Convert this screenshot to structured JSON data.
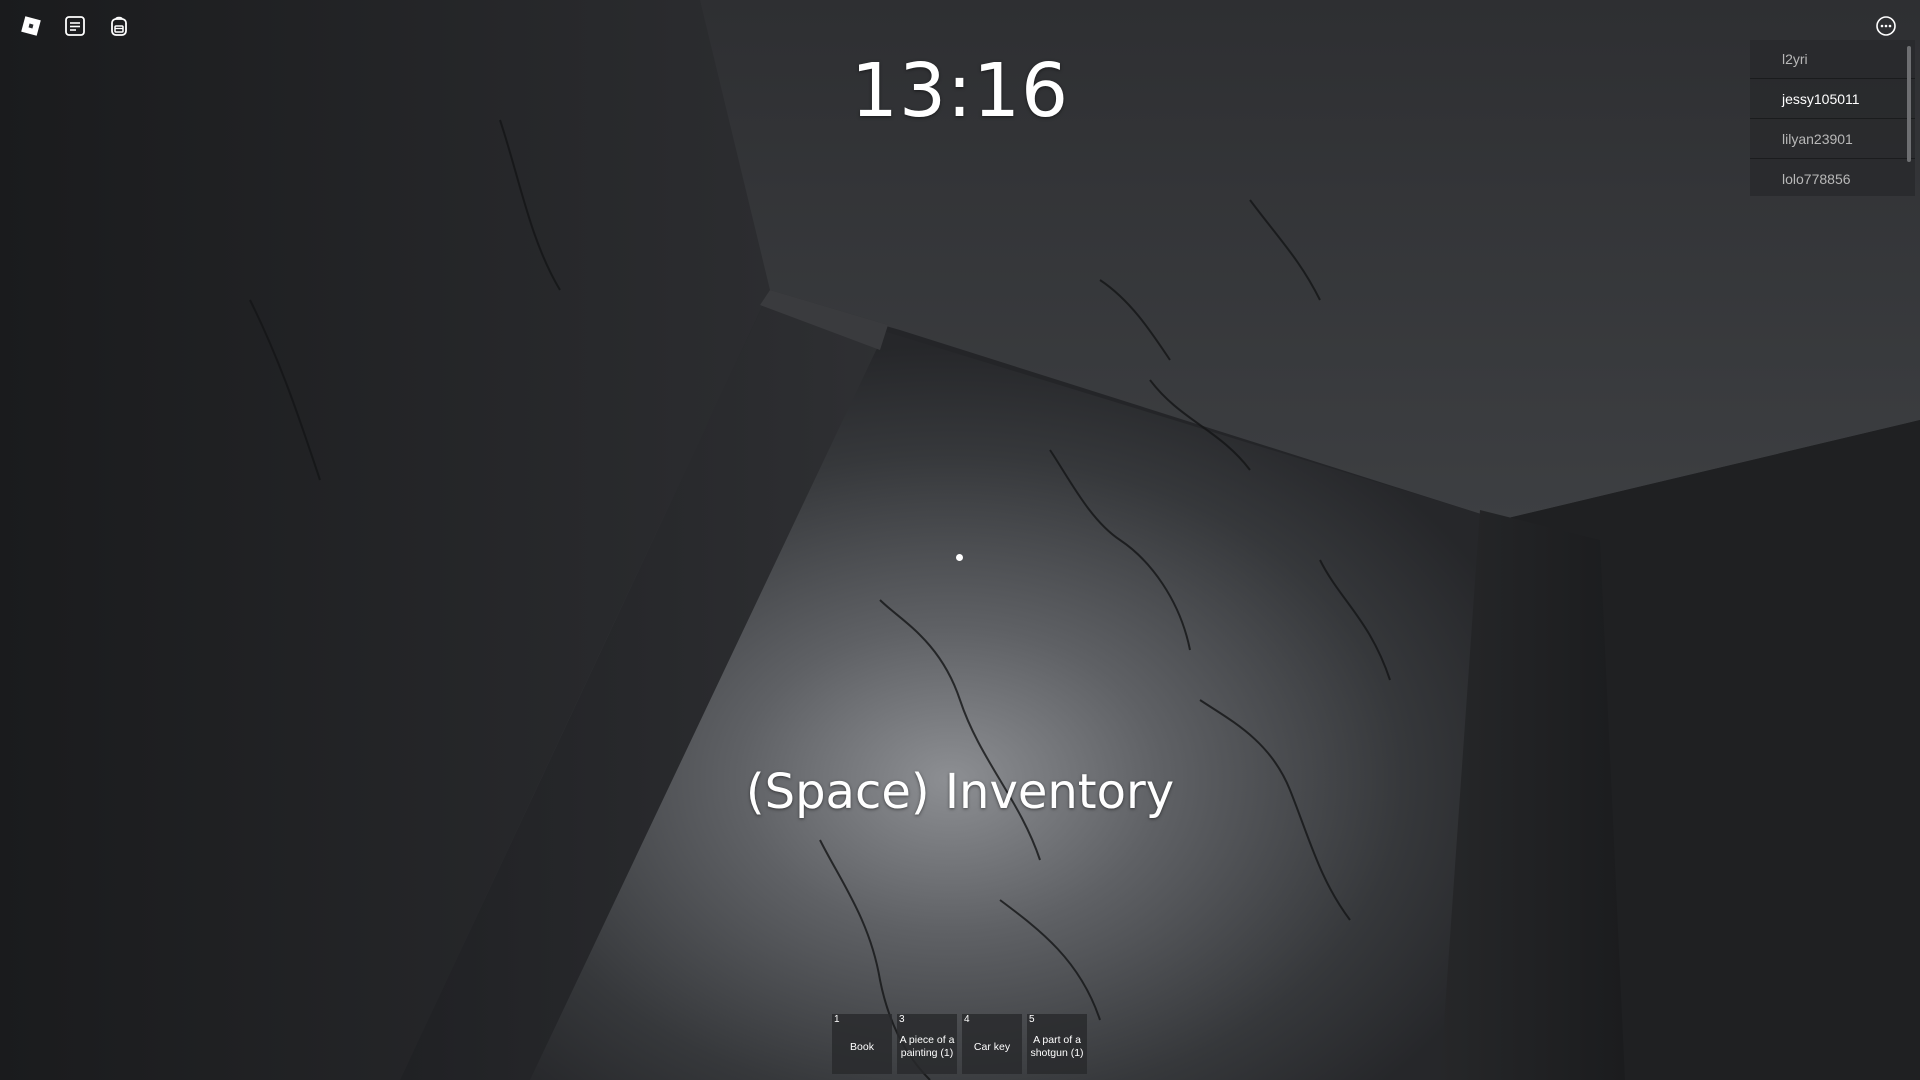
{
  "hud": {
    "clock": "13:16",
    "inventory_hint": "(Space) Inventory"
  },
  "core_buttons": {
    "roblox_menu": "roblox-logo-icon",
    "chat": "chat-icon",
    "backpack": "backpack-icon",
    "more": "more-options-icon"
  },
  "player_list": {
    "players": [
      {
        "name": "l2yri"
      },
      {
        "name": "jessy105011"
      },
      {
        "name": "lilyan23901"
      },
      {
        "name": "lolo778856"
      }
    ],
    "highlighted": "jessy105011"
  },
  "hotbar": {
    "slots": [
      {
        "key": "1",
        "label": "Book"
      },
      {
        "key": "3",
        "label": "A piece of a painting (1)"
      },
      {
        "key": "4",
        "label": "Car key"
      },
      {
        "key": "5",
        "label": "A part of a shotgun (1)"
      }
    ]
  },
  "colors": {
    "wall": "#2a2b2e",
    "floor_light": "#8a8c90",
    "ui_panel": "#28292c",
    "text": "#ffffff"
  }
}
